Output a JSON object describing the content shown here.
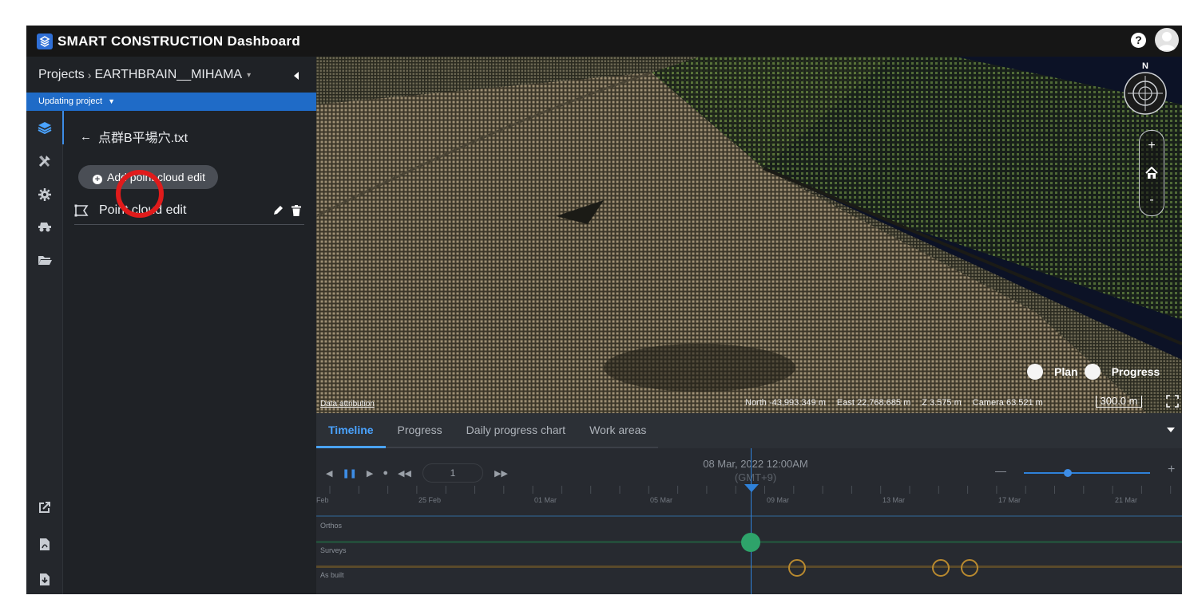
{
  "app": {
    "title": "SMART CONSTRUCTION Dashboard"
  },
  "header": {
    "help_icon": "question-circle-icon",
    "avatar": "user-avatar"
  },
  "breadcrumb": {
    "root": "Projects",
    "separator": "›",
    "project": "EARTHBRAIN__MIHAMA"
  },
  "status": {
    "text": "Updating project"
  },
  "panel": {
    "file_title": "点群B平場穴.txt",
    "add_button_label": "Add point cloud edit",
    "edit_item_label": "Point cloud edit"
  },
  "viewport": {
    "attribution": "Data attribution",
    "north": "North -43,993.349 m",
    "east": "East 22,768.685 m",
    "z": "Z 3.575 m",
    "camera": "Camera 63.521 m",
    "scale": "300.0 m",
    "compass_label": "N",
    "zoom_in": "+",
    "zoom_out": "-",
    "toggle_plan": "Plan",
    "toggle_progress": "Progress"
  },
  "bottom": {
    "tabs": [
      "Timeline",
      "Progress",
      "Daily progress chart",
      "Work areas"
    ],
    "speed": "1",
    "current_date": "08 Mar, 2022 12:00AM",
    "timezone": "(GMT+9)",
    "zoom_minus": "—",
    "zoom_plus": "+",
    "zoom_level": 0.35,
    "dates": [
      "Feb",
      "25 Feb",
      "01 Mar",
      "05 Mar",
      "09 Mar",
      "13 Mar",
      "17 Mar",
      "21 Mar"
    ],
    "tracks": [
      "Orthos",
      "Surveys",
      "As built"
    ]
  },
  "colors": {
    "accent": "#2f81d9",
    "status_bar": "#1f6bc7",
    "highlight": "#e01b1b",
    "survey": "#2ea36a",
    "asbuilt": "#b8892f"
  }
}
